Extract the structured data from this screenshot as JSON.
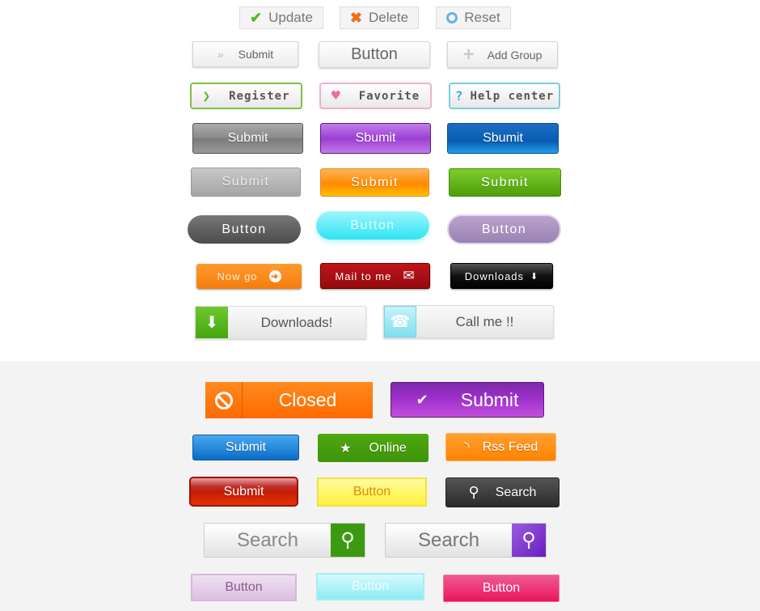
{
  "row1": [
    {
      "label": "Update",
      "icon": "check-icon"
    },
    {
      "label": "Delete",
      "icon": "x-icon"
    },
    {
      "label": "Reset",
      "icon": "circle-icon"
    }
  ],
  "row2": [
    {
      "label": "Submit",
      "icon": "double-chevron-icon"
    },
    {
      "label": "Button"
    },
    {
      "label": "Add Group",
      "icon": "plus-icon"
    }
  ],
  "row3": [
    {
      "label": "Register",
      "icon": "chevron-right-icon"
    },
    {
      "label": "Favorite",
      "icon": "heart-icon"
    },
    {
      "label": "Help center",
      "icon": "question-icon"
    }
  ],
  "row4": [
    {
      "label": "Submit"
    },
    {
      "label": "Sbumit"
    },
    {
      "label": "Sbumit"
    }
  ],
  "row5": [
    {
      "label": "Submit"
    },
    {
      "label": "Submit"
    },
    {
      "label": "Submit"
    }
  ],
  "row6": [
    {
      "label": "Button"
    },
    {
      "label": "Button"
    },
    {
      "label": "Button"
    }
  ],
  "row7": [
    {
      "label": "Now go",
      "icon": "arrow-right-circle-icon"
    },
    {
      "label": "Mail to me",
      "icon": "mail-icon"
    },
    {
      "label": "Downloads",
      "icon": "arrow-down-icon"
    }
  ],
  "row8": [
    {
      "label": "Downloads!",
      "icon": "download-icon"
    },
    {
      "label": "Call me !!",
      "icon": "phone-icon"
    }
  ],
  "row9": [
    {
      "label": "Closed",
      "icon": "prohibited-icon"
    },
    {
      "label": "Submit",
      "icon": "check-icon"
    }
  ],
  "row10": [
    {
      "label": "Submit"
    },
    {
      "label": "Online",
      "icon": "star-icon"
    },
    {
      "label": "Rss Feed",
      "icon": "rss-icon"
    }
  ],
  "row11": [
    {
      "label": "Submit"
    },
    {
      "label": "Button"
    },
    {
      "label": "Search",
      "icon": "search-icon"
    }
  ],
  "row12": [
    {
      "label": "Search",
      "icon": "search-icon"
    },
    {
      "label": "Search",
      "icon": "search-icon"
    }
  ],
  "row13": [
    {
      "label": "Button"
    },
    {
      "label": "Button"
    },
    {
      "label": "Button"
    }
  ]
}
